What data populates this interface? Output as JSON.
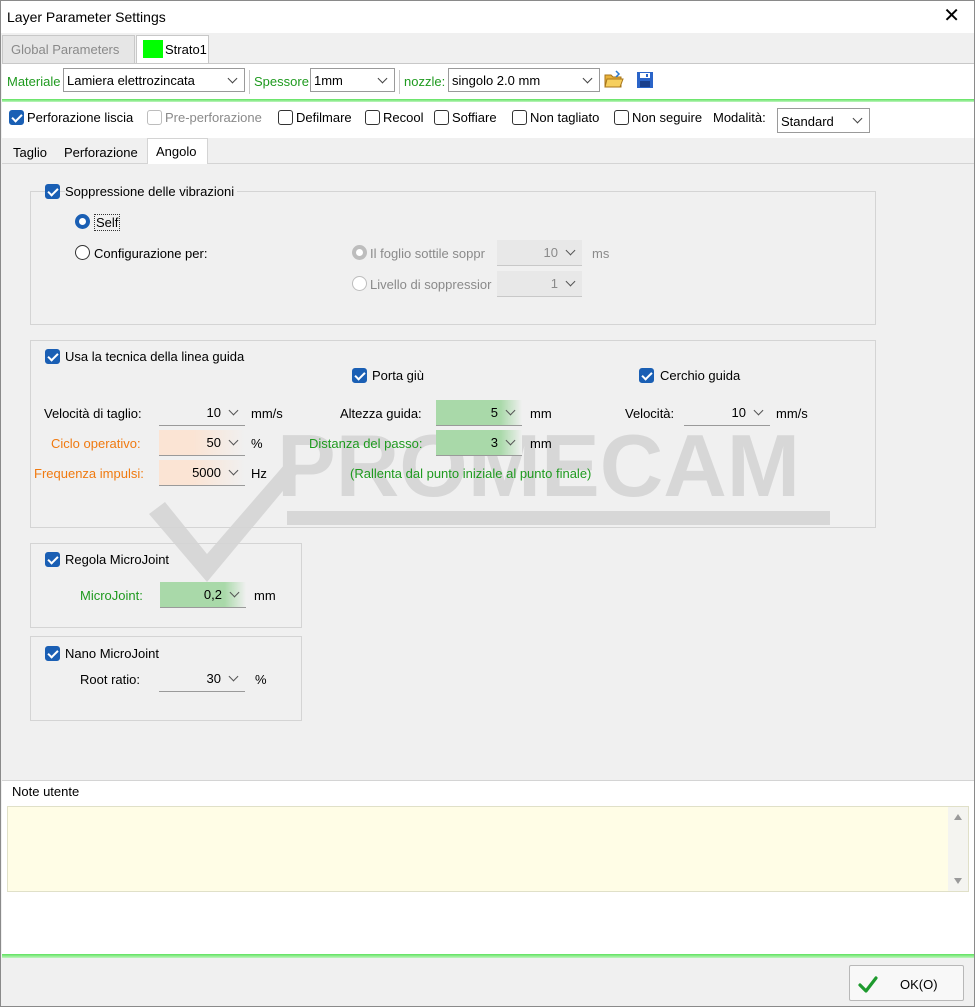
{
  "window": {
    "title": "Layer Parameter Settings",
    "close": "✕"
  },
  "doc_tabs": [
    {
      "label": "Global Parameters",
      "active": false
    },
    {
      "label": "Strato1",
      "active": true,
      "color": "#00ff00"
    }
  ],
  "toolbar": {
    "material_label": "Materiale",
    "material_value": "Lamiera elettrozincata",
    "thickness_label": "Spessore",
    "thickness_value": "1mm",
    "nozzle_label": "nozzle:",
    "nozzle_value": "singolo 2.0 mm"
  },
  "options": {
    "perforazione_liscia": {
      "label": "Perforazione liscia",
      "checked": true
    },
    "pre_perforazione": {
      "label": "Pre-perforazione",
      "checked": false,
      "disabled": true
    },
    "defilmare": {
      "label": "Defilmare",
      "checked": false
    },
    "recool": {
      "label": "Recool",
      "checked": false
    },
    "soffiare": {
      "label": "Soffiare",
      "checked": false
    },
    "non_tagliato": {
      "label": "Non tagliato",
      "checked": false
    },
    "non_seguire": {
      "label": "Non seguire",
      "checked": false
    },
    "modalita_label": "Modalità:",
    "modalita_value": "Standard"
  },
  "sub_tabs": [
    "Taglio",
    "Perforazione",
    "Angolo"
  ],
  "active_sub_tab": "Angolo",
  "vibration": {
    "title": "Soppressione delle vibrazioni",
    "self_label": "Self",
    "config_label": "Configurazione per:",
    "foglio_label": "Il foglio sottile soppr",
    "foglio_value": "10",
    "foglio_unit": "ms",
    "livello_label": "Livello di soppressior",
    "livello_value": "1"
  },
  "guide": {
    "title": "Usa la tecnica della linea guida",
    "porta_giu": "Porta giù",
    "cerchio_guida": "Cerchio guida",
    "velocita_taglio_label": "Velocità di taglio:",
    "velocita_taglio_value": "10",
    "velocita_taglio_unit": "mm/s",
    "ciclo_label": "Ciclo operativo:",
    "ciclo_value": "50",
    "ciclo_unit": "%",
    "frequenza_label": "Frequenza impulsi:",
    "frequenza_value": "5000",
    "frequenza_unit": "Hz",
    "altezza_label": "Altezza guida:",
    "altezza_value": "5",
    "altezza_unit": "mm",
    "distanza_label": "Distanza del passo:",
    "distanza_value": "3",
    "distanza_unit": "mm",
    "rallenta_note": "(Rallenta dal punto iniziale al punto finale)",
    "velocita_label": "Velocità:",
    "velocita_value": "10",
    "velocita_unit": "mm/s"
  },
  "microjoint": {
    "title": "Regola MicroJoint",
    "label": "MicroJoint:",
    "value": "0,2",
    "unit": "mm"
  },
  "nano": {
    "title": "Nano MicroJoint",
    "root_label": "Root ratio:",
    "root_value": "30",
    "root_unit": "%"
  },
  "notes": {
    "label": "Note utente",
    "value": ""
  },
  "watermark": "PROMECAM",
  "ok_button": "OK(O)",
  "colors": {
    "accent": "#1a5fb4",
    "green_label": "#1f9a1f",
    "orange_label": "#f07a10",
    "notes_bg": "#fffde6"
  }
}
